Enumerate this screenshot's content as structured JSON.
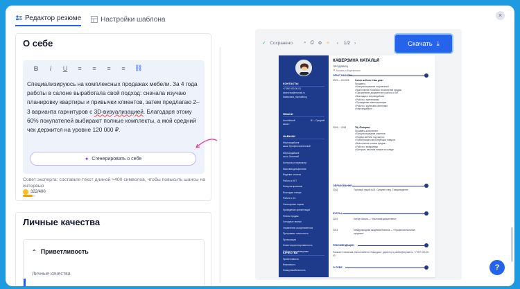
{
  "close": "×",
  "tabs": [
    {
      "label": "Редактор резюме"
    },
    {
      "label": "Настройки шаблона"
    }
  ],
  "about": {
    "title": "О себе",
    "toolbar": [
      "B",
      "I",
      "U",
      "≡",
      "≡",
      "≡",
      "≡",
      "⛓"
    ],
    "text_part1": "Специализируюсь на комплексных продажах мебели. За 4 года работы в салоне выработала свой подход: сначала изучаю планировку квартиры и привычки клиентов, затем предлагаю 2–3 варианта гарнитуров с ",
    "text_wavy": "3D-визуализацией",
    "text_part2": ". Благодаря этому 60% покупателей выбирают полные комплекты, а мой средний чек держится на уровне 120 000 ₽.",
    "generate_label": "Сгенерировать о себе",
    "hint": "Совет эксперта: составьте текст длиной ≈400 символов, чтобы повысить шансы на интервью",
    "counter": "322/400",
    "counter_progress": 0.805
  },
  "qualities": {
    "title": "Личные качества",
    "item_title": "Приветливость",
    "item_sub": "Личные качества"
  },
  "preview": {
    "saved": "Сохранено",
    "page": "1/2",
    "download_label": "Скачать"
  },
  "resume": {
    "name": "КАВЕРЗИНА НАТАЛЬЯ",
    "position": "ПРОДАВЕЦ",
    "location": "Москва, м Фрунзенская",
    "sidebar": {
      "contacts_head": "КОНТАКТЫ",
      "phone": "+7 900 000-00-01",
      "email": "kaverzina@mymail.ru",
      "site": "Каверзина_mymailblog",
      "languages_head": "ЯЗЫКИ",
      "lang1": "Английский",
      "lang1_level": "B1 - Средний",
      "skills_head": "НАВЫКИ",
      "skills": [
        "Мерчандайзинг",
        "Мерчандайзинг",
        "Контроль и пересмотр",
        "Кассовая дисциплина",
        "Ведение отчетов",
        "Работа с ККТ",
        "Консультирование",
        "Выкладка товара",
        "Работа с 1С",
        "Санитарные нормы",
        "Проведение презентаций",
        "Планы продаж",
        "Холодные звонки",
        "Управление ассортиментом",
        "Программы лояльности",
        "Промоакции",
        "Клиентоориентированность",
        "Работа с рекламациями"
      ],
      "skill1_level": "Профессиональный",
      "skill2_level": "Опытный",
      "qualities_head": "КАЧЕСТВА",
      "qualities": [
        "Приветливость",
        "Вежливость",
        "Коммуникабельность"
      ]
    },
    "experience_head": "ОПЫТ РАБОТЫ",
    "jobs": [
      {
        "dates": "2019 — 03.2025",
        "company": "Салон мебели «Наш дом»",
        "title": "Продавец",
        "bullets": [
          "Консультирование покупателей",
          "Выполнение плановых показателей продаж",
          "Оформление документов и работа с ККТ",
          "Выкладка и мерчандайзинг",
          "Работа с претензиями",
          "Проведение инвентаризации",
          "Работа с крупными клиентами",
          "Мерчандайзинг"
        ]
      },
      {
        "dates": "2018 — 2019",
        "company": "ТЦ «Полярис»",
        "title": "Продавец-консультант",
        "bullets": [
          "Консультирование клиентов",
          "Подбор мебели под запрос",
          "Презентация сопутствующих товаров",
          "Выполнение планов продаж",
          "Работа с возвратами",
          "Контроль наличия товара на складе"
        ]
      }
    ],
    "education_head": "ОБРАЗОВАНИЕ",
    "education": {
      "dates": "2018",
      "text": "Торговый лицей №31, Среднее спец. Товароведение"
    },
    "courses_head": "КУРСЫ",
    "courses": [
      {
        "dates": "2024",
        "text": "Контур Школа — «Кассовая дисциплина»"
      },
      {
        "dates": "2023",
        "text": "Международная академия бизнеса — «Профессиональные продажи»"
      }
    ],
    "recs_head": "РЕКОМЕНДАЦИИ",
    "rec": "Панькин Станислав, Салон мебели «Наш дом», директор s.pankin@mymail.ru, +7 997 000-00-00",
    "about_head": "О СЕБЕ"
  },
  "help_label": "?",
  "colors": {
    "accent": "#2563eb",
    "resume_sidebar": "#1e3a8a",
    "background": "#1e9be0"
  }
}
